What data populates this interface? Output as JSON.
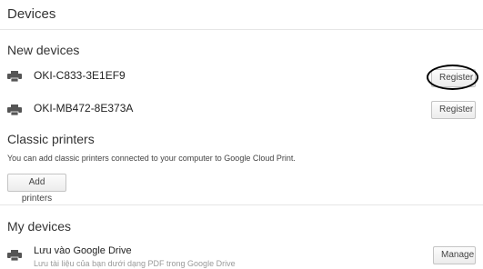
{
  "page": {
    "title": "Devices"
  },
  "new_devices": {
    "heading": "New devices",
    "items": [
      {
        "name": "OKI-C833-3E1EF9",
        "button_label": "Register",
        "icon": "printer-icon"
      },
      {
        "name": "OKI-MB472-8E373A",
        "button_label": "Register",
        "icon": "printer-icon"
      }
    ]
  },
  "classic_printers": {
    "heading": "Classic printers",
    "description": "You can add classic printers connected to your computer to Google Cloud Print.",
    "add_button_label": "Add printers"
  },
  "my_devices": {
    "heading": "My devices",
    "items": [
      {
        "name": "Lưu vào Google Drive",
        "subtitle": "Lưu tài liệu của bạn dưới dạng PDF trong Google Drive",
        "button_label": "Manage",
        "icon": "printer-icon"
      }
    ]
  }
}
